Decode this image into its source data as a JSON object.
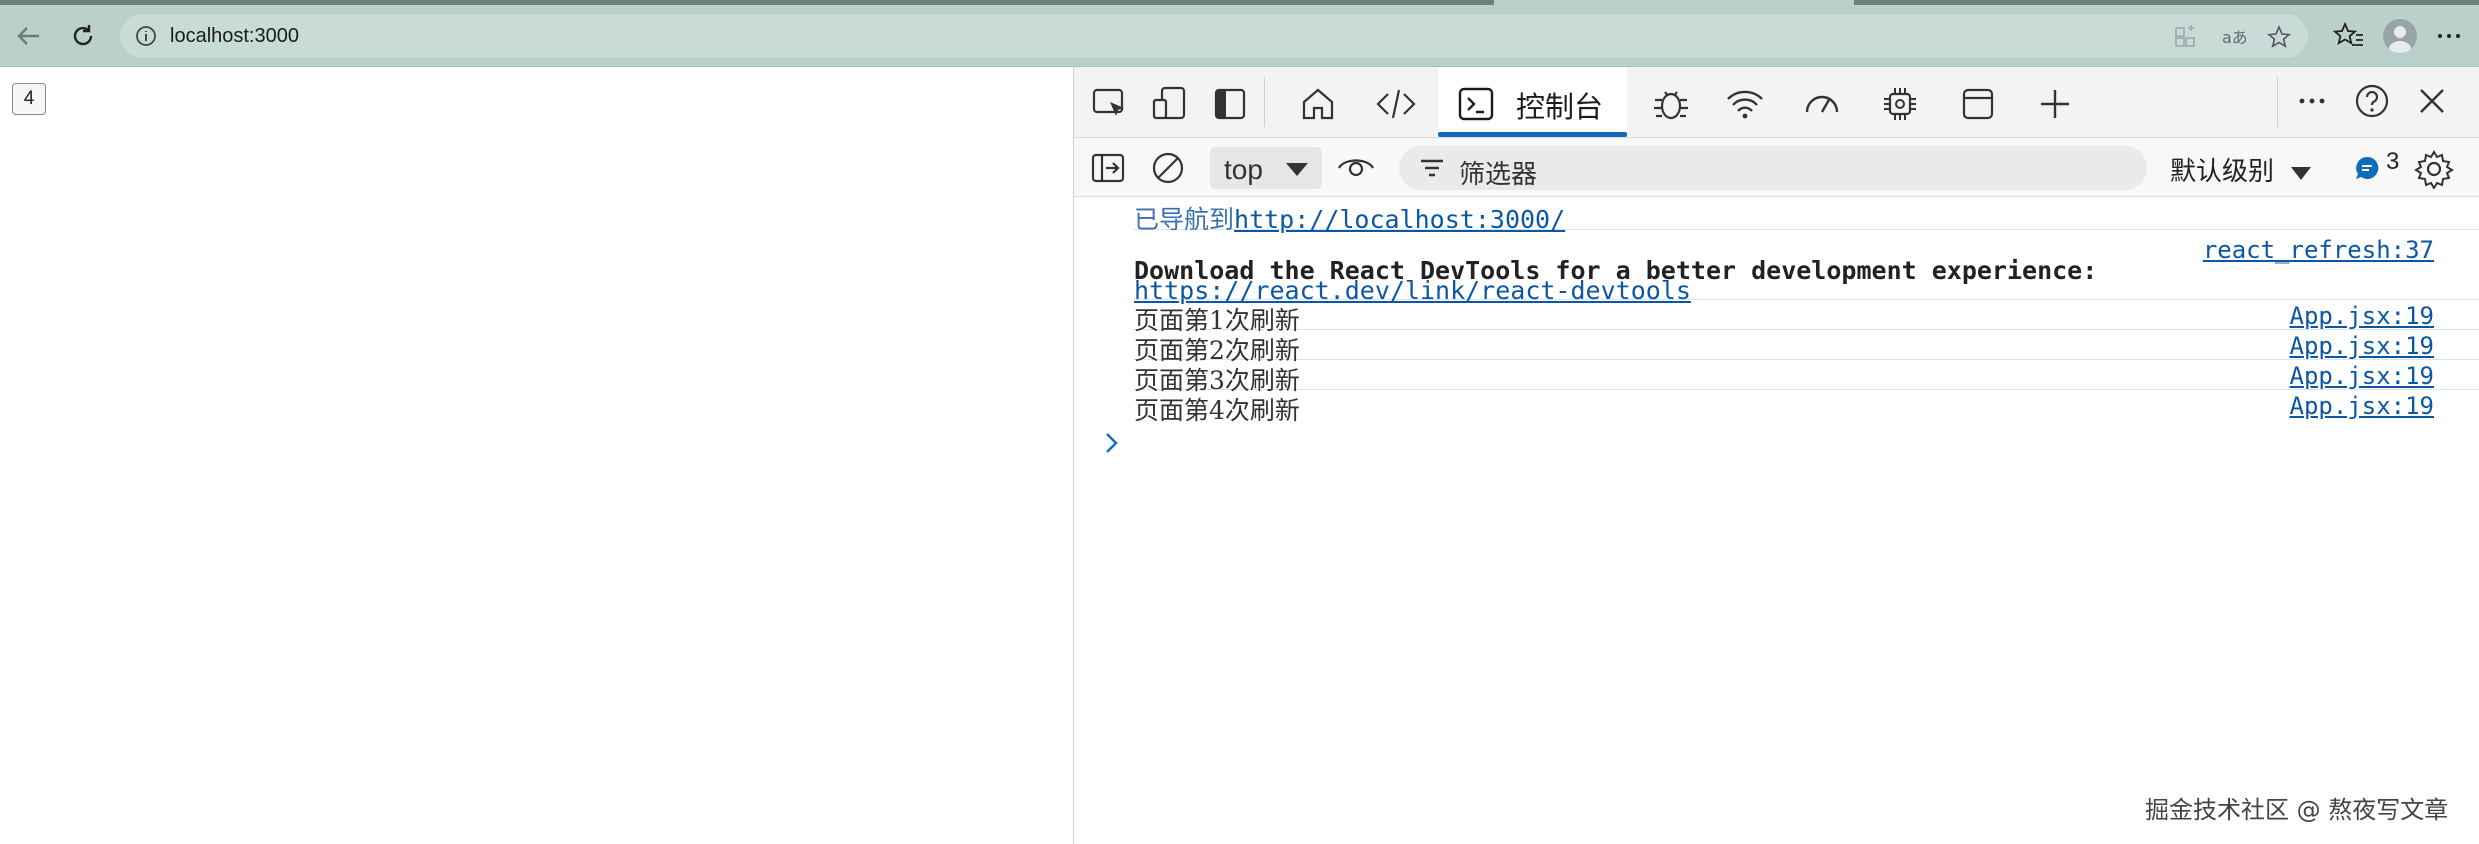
{
  "browser": {
    "url": "localhost:3000"
  },
  "page": {
    "counter_value": "4"
  },
  "devtools": {
    "active_tab_label": "控制台",
    "context_label": "top",
    "filter_placeholder": "筛选器",
    "levels_label": "默认级别",
    "issues_count": "3",
    "console": {
      "nav_text": "已导航到",
      "nav_url": "http://localhost:3000/",
      "devtools_source": "react_refresh:37",
      "devtools_msg": "Download the React DevTools for a better development experience:",
      "devtools_link": "https://react.dev/link/react-devtools",
      "logs": [
        {
          "text": "页面第1次刷新",
          "source": "App.jsx:19"
        },
        {
          "text": "页面第2次刷新",
          "source": "App.jsx:19"
        },
        {
          "text": "页面第3次刷新",
          "source": "App.jsx:19"
        },
        {
          "text": "页面第4次刷新",
          "source": "App.jsx:19"
        }
      ]
    }
  },
  "watermark": "掘金技术社区 @ 熬夜写文章",
  "colors": {
    "chrome_bg": "#b9d0cb",
    "accent": "#0f6cbd",
    "link": "#0b57a6"
  }
}
